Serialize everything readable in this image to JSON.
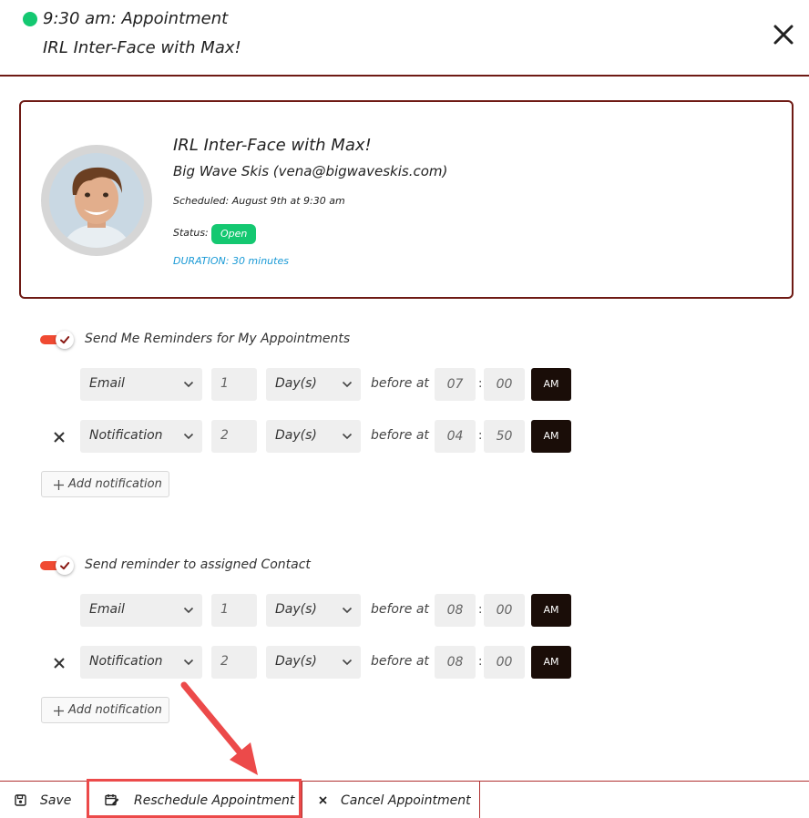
{
  "header": {
    "title": "9:30 am: Appointment",
    "subtitle": "IRL Inter-Face with Max!",
    "status_color": "#14c871",
    "close_icon": "close-icon"
  },
  "card": {
    "title": "IRL Inter-Face with Max!",
    "company": "Big Wave Skis (vena@bigwaveskis.com)",
    "scheduled": "Scheduled: August 9th at 9:30 am",
    "status_label": "Status:",
    "status_value": "Open",
    "status_color": "#14c871",
    "duration": "DURATION: 30 minutes",
    "border_color": "#6e1a14"
  },
  "my_reminders": {
    "toggle_label": "Send Me Reminders for My Appointments",
    "enabled": true,
    "rows": [
      {
        "type": "Email",
        "amount": "1",
        "unit": "Day(s)",
        "before_at": "before at",
        "hour": "07",
        "minute": "00",
        "ampm": "AM",
        "removable": false
      },
      {
        "type": "Notification",
        "amount": "2",
        "unit": "Day(s)",
        "before_at": "before at",
        "hour": "04",
        "minute": "50",
        "ampm": "AM",
        "removable": true
      }
    ],
    "add_label": "Add notification"
  },
  "contact_reminders": {
    "toggle_label": "Send reminder to assigned Contact",
    "enabled": true,
    "rows": [
      {
        "type": "Email",
        "amount": "1",
        "unit": "Day(s)",
        "before_at": "before at",
        "hour": "08",
        "minute": "00",
        "ampm": "AM",
        "removable": false
      },
      {
        "type": "Notification",
        "amount": "2",
        "unit": "Day(s)",
        "before_at": "before at",
        "hour": "08",
        "minute": "00",
        "ampm": "AM",
        "removable": true
      }
    ],
    "add_label": "Add notification"
  },
  "time_separator": ":",
  "footer": {
    "save_label": "Save",
    "reschedule_label": "Reschedule Appointment",
    "cancel_label": "Cancel Appointment"
  },
  "colors": {
    "accent": "#f04a32",
    "dark_button": "#1a0d08",
    "link": "#1a9ad6",
    "annotation": "#ec4a4a"
  }
}
